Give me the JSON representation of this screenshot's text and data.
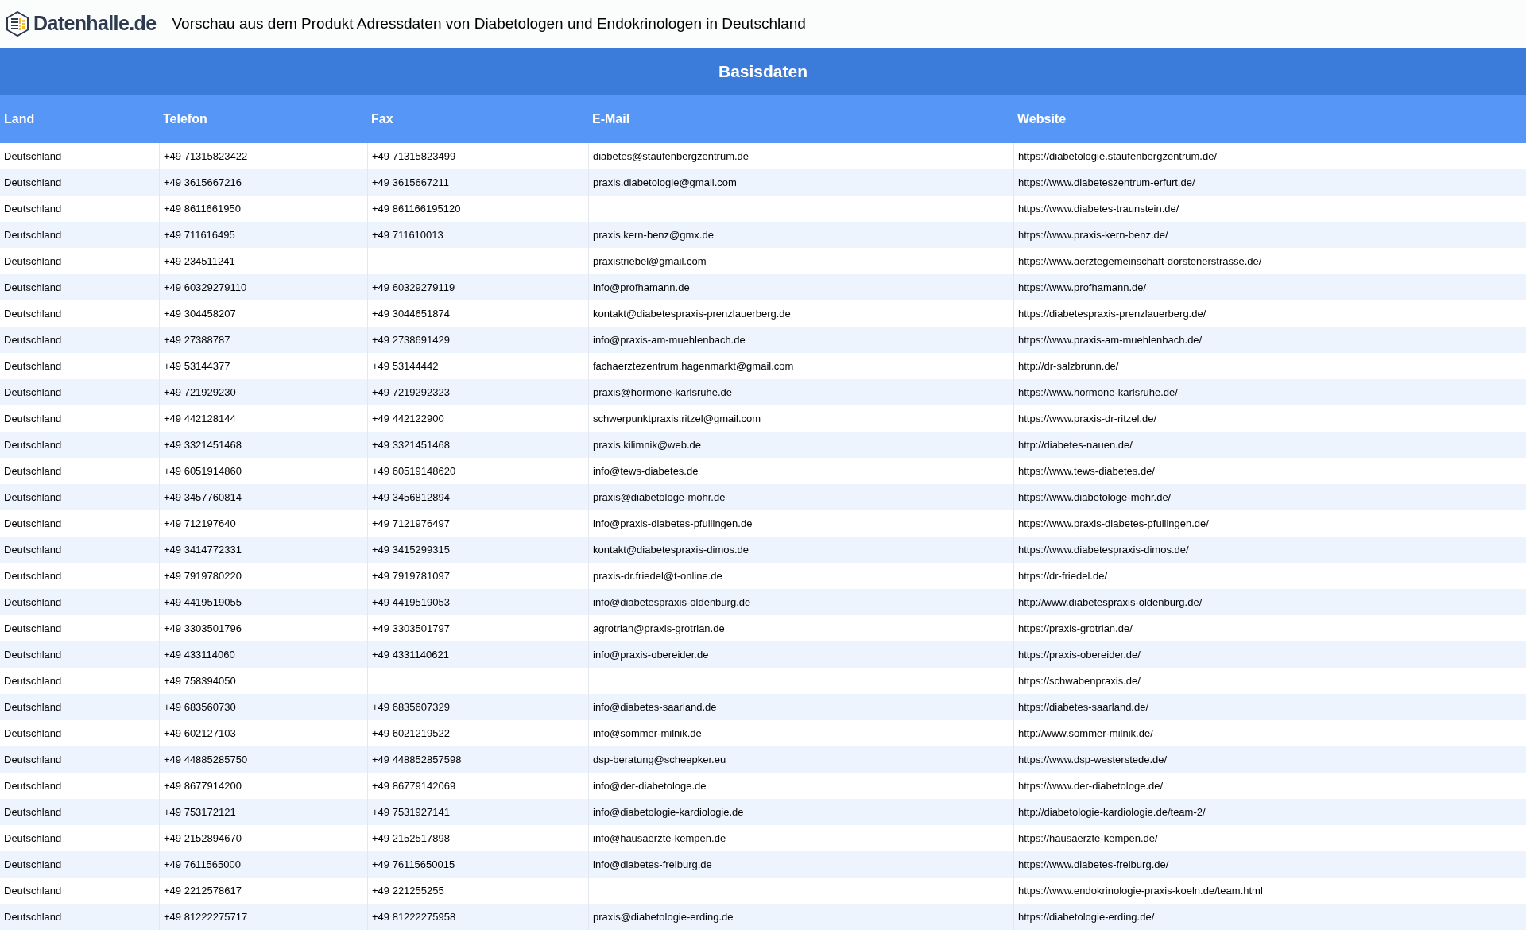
{
  "header": {
    "logo_text": "Datenhalle.de",
    "title": "Vorschau aus dem Produkt Adressdaten von Diabetologen und Endokrinologen in Deutschland"
  },
  "table": {
    "section_title": "Basisdaten",
    "columns": [
      "Land",
      "Telefon",
      "Fax",
      "E-Mail",
      "Website"
    ],
    "rows": [
      {
        "land": "Deutschland",
        "telefon": "+49 71315823422",
        "fax": "+49 71315823499",
        "email": "diabetes@staufenbergzentrum.de",
        "website": "https://diabetologie.staufenbergzentrum.de/"
      },
      {
        "land": "Deutschland",
        "telefon": "+49 3615667216",
        "fax": "+49 3615667211",
        "email": "praxis.diabetologie@gmail.com",
        "website": "https://www.diabeteszentrum-erfurt.de/"
      },
      {
        "land": "Deutschland",
        "telefon": "+49 8611661950",
        "fax": "+49 861166195120",
        "website": "https://www.diabetes-traunstein.de/"
      },
      {
        "land": "Deutschland",
        "telefon": "+49 711616495",
        "fax": "+49 711610013",
        "email": "praxis.kern-benz@gmx.de",
        "website": "https://www.praxis-kern-benz.de/"
      },
      {
        "land": "Deutschland",
        "telefon": "+49 234511241",
        "email": "praxistriebel@gmail.com",
        "website": "https://www.aerztegemeinschaft-dorstenerstrasse.de/"
      },
      {
        "land": "Deutschland",
        "telefon": "+49 60329279110",
        "fax": "+49 60329279119",
        "email": "info@profhamann.de",
        "website": "https://www.profhamann.de/"
      },
      {
        "land": "Deutschland",
        "telefon": "+49 304458207",
        "fax": "+49 3044651874",
        "email": "kontakt@diabetespraxis-prenzlauerberg.de",
        "website": "https://diabetespraxis-prenzlauerberg.de/"
      },
      {
        "land": "Deutschland",
        "telefon": "+49 27388787",
        "fax": "+49 2738691429",
        "email": "info@praxis-am-muehlenbach.de",
        "website": "https://www.praxis-am-muehlenbach.de/"
      },
      {
        "land": "Deutschland",
        "telefon": "+49 53144377",
        "fax": "+49 53144442",
        "email": "fachaerztezentrum.hagenmarkt@gmail.com",
        "website": "http://dr-salzbrunn.de/"
      },
      {
        "land": "Deutschland",
        "telefon": "+49 721929230",
        "fax": "+49 7219292323",
        "email": "praxis@hormone-karlsruhe.de",
        "website": "https://www.hormone-karlsruhe.de/"
      },
      {
        "land": "Deutschland",
        "telefon": "+49 442128144",
        "fax": "+49 442122900",
        "email": "schwerpunktpraxis.ritzel@gmail.com",
        "website": "https://www.praxis-dr-ritzel.de/"
      },
      {
        "land": "Deutschland",
        "telefon": "+49 3321451468",
        "fax": "+49 3321451468",
        "email": "praxis.kilimnik@web.de",
        "website": "http://diabetes-nauen.de/"
      },
      {
        "land": "Deutschland",
        "telefon": "+49 6051914860",
        "fax": "+49 60519148620",
        "email": "info@tews-diabetes.de",
        "website": "https://www.tews-diabetes.de/"
      },
      {
        "land": "Deutschland",
        "telefon": "+49 3457760814",
        "fax": "+49 3456812894",
        "email": "praxis@diabetologe-mohr.de",
        "website": "https://www.diabetologe-mohr.de/"
      },
      {
        "land": "Deutschland",
        "telefon": "+49 712197640",
        "fax": "+49 7121976497",
        "email": "info@praxis-diabetes-pfullingen.de",
        "website": "https://www.praxis-diabetes-pfullingen.de/"
      },
      {
        "land": "Deutschland",
        "telefon": "+49 3414772331",
        "fax": "+49 3415299315",
        "email": "kontakt@diabetespraxis-dimos.de",
        "website": "https://www.diabetespraxis-dimos.de/"
      },
      {
        "land": "Deutschland",
        "telefon": "+49 7919780220",
        "fax": "+49 7919781097",
        "email": "praxis-dr.friedel@t-online.de",
        "website": "https://dr-friedel.de/"
      },
      {
        "land": "Deutschland",
        "telefon": "+49 4419519055",
        "fax": "+49 4419519053",
        "email": "info@diabetespraxis-oldenburg.de",
        "website": "http://www.diabetespraxis-oldenburg.de/"
      },
      {
        "land": "Deutschland",
        "telefon": "+49 3303501796",
        "fax": "+49 3303501797",
        "email": "agrotrian@praxis-grotrian.de",
        "website": "https://praxis-grotrian.de/"
      },
      {
        "land": "Deutschland",
        "telefon": "+49 433114060",
        "fax": "+49 4331140621",
        "email": "info@praxis-obereider.de",
        "website": "https://praxis-obereider.de/"
      },
      {
        "land": "Deutschland",
        "telefon": "+49 758394050",
        "website": "https://schwabenpraxis.de/"
      },
      {
        "land": "Deutschland",
        "telefon": "+49 683560730",
        "fax": "+49 6835607329",
        "email": "info@diabetes-saarland.de",
        "website": "https://diabetes-saarland.de/"
      },
      {
        "land": "Deutschland",
        "telefon": "+49 602127103",
        "fax": "+49 6021219522",
        "email": "info@sommer-milnik.de",
        "website": "http://www.sommer-milnik.de/"
      },
      {
        "land": "Deutschland",
        "telefon": "+49 44885285750",
        "fax": "+49 448852857598",
        "email": "dsp-beratung@scheepker.eu",
        "website": "https://www.dsp-westerstede.de/"
      },
      {
        "land": "Deutschland",
        "telefon": "+49 8677914200",
        "fax": "+49 86779142069",
        "email": "info@der-diabetologe.de",
        "website": "https://www.der-diabetologe.de/"
      },
      {
        "land": "Deutschland",
        "telefon": "+49 753172121",
        "fax": "+49 7531927141",
        "email": "info@diabetologie-kardiologie.de",
        "website": "http://diabetologie-kardiologie.de/team-2/"
      },
      {
        "land": "Deutschland",
        "telefon": "+49 2152894670",
        "fax": "+49 2152517898",
        "email": "info@hausaerzte-kempen.de",
        "website": "https://hausaerzte-kempen.de/"
      },
      {
        "land": "Deutschland",
        "telefon": "+49 7611565000",
        "fax": "+49 76115650015",
        "email": "info@diabetes-freiburg.de",
        "website": "https://www.diabetes-freiburg.de/"
      },
      {
        "land": "Deutschland",
        "telefon": "+49 2212578617",
        "fax": "+49 221255255",
        "website": "https://www.endokrinologie-praxis-koeln.de/team.html"
      },
      {
        "land": "Deutschland",
        "telefon": "+49 81222275717",
        "fax": "+49 81222275958",
        "email": "praxis@diabetologie-erding.de",
        "website": "https://diabetologie-erding.de/"
      }
    ]
  }
}
